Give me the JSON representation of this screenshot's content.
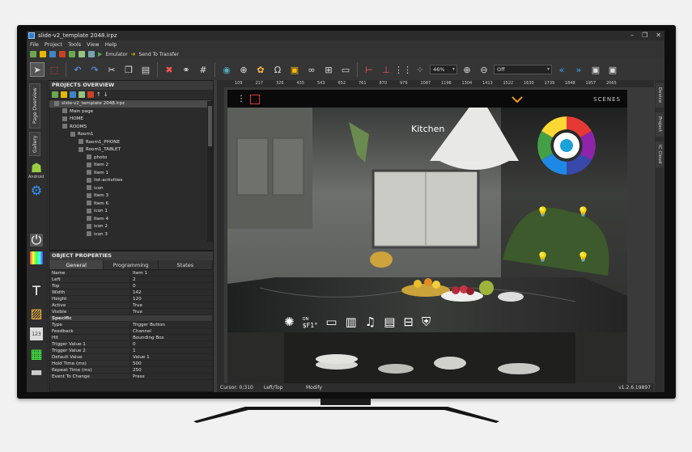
{
  "window": {
    "title": "slide-v2_template 2048.irpz",
    "min": "–",
    "max": "❐",
    "close": "✕"
  },
  "menu": [
    "File",
    "Project",
    "Tools",
    "View",
    "Help"
  ],
  "toolbar1": {
    "emulator": "Emulator",
    "send": "Send To Transfer"
  },
  "toolbar2": {
    "zoom": "46%",
    "off_select": "Off"
  },
  "left_tabs": {
    "page_overview": "Page Overview",
    "gallery": "Gallery",
    "android": "Android"
  },
  "projects_overview": {
    "header": "PROJECTS OVERVIEW",
    "tree": [
      {
        "label": "slide-v2_template 2048.irpz",
        "level": 0
      },
      {
        "label": "Main page",
        "level": 1
      },
      {
        "label": "HOME",
        "level": 1
      },
      {
        "label": "ROOMS",
        "level": 1
      },
      {
        "label": "Room1",
        "level": 2
      },
      {
        "label": "Room1_PHONE",
        "level": 3
      },
      {
        "label": "Room1_TABLET",
        "level": 3
      },
      {
        "label": "photo",
        "level": 4
      },
      {
        "label": "Item 2",
        "level": 4
      },
      {
        "label": "Item 1",
        "level": 4
      },
      {
        "label": "list-activities",
        "level": 4
      },
      {
        "label": "icon",
        "level": 4
      },
      {
        "label": "Item 3",
        "level": 4
      },
      {
        "label": "Item 6",
        "level": 4
      },
      {
        "label": "icon 1",
        "level": 4
      },
      {
        "label": "Item 4",
        "level": 4
      },
      {
        "label": "icon 2",
        "level": 4
      },
      {
        "label": "icon 3",
        "level": 4
      }
    ]
  },
  "object_properties": {
    "header": "OBJECT PROPERTIES",
    "tabs": [
      "General",
      "Programming",
      "States"
    ],
    "rows": [
      {
        "k": "Name",
        "v": "Item 1"
      },
      {
        "k": "Left",
        "v": "2"
      },
      {
        "k": "Top",
        "v": "0"
      },
      {
        "k": "Width",
        "v": "142"
      },
      {
        "k": "Height",
        "v": "120"
      },
      {
        "k": "Active",
        "v": "True"
      },
      {
        "k": "Visible",
        "v": "True"
      },
      {
        "k": "Specific",
        "v": "",
        "section": true
      },
      {
        "k": "Type",
        "v": "Trigger Button"
      },
      {
        "k": "Feedback",
        "v": "Channel"
      },
      {
        "k": "Hit",
        "v": "Bounding Box"
      },
      {
        "k": "Trigger Value 1",
        "v": "0"
      },
      {
        "k": "Trigger Value 2",
        "v": "1"
      },
      {
        "k": "Default Value",
        "v": "Value 1"
      },
      {
        "k": "Hold Time (ms)",
        "v": "500"
      },
      {
        "k": "Repeat Time (ms)",
        "v": "250"
      },
      {
        "k": "Event To Change",
        "v": "Press"
      }
    ]
  },
  "ruler_ticks": [
    "109",
    "217",
    "326",
    "435",
    "543",
    "652",
    "761",
    "870",
    "979",
    "1087",
    "1196",
    "1304",
    "1413",
    "1522",
    "1630",
    "1739",
    "1848",
    "1957",
    "2065"
  ],
  "right_tabs": [
    "Device",
    "Project",
    "IC Cloud"
  ],
  "slide": {
    "room_title": "Kitchen",
    "scenes": "SCENES",
    "ac_on": "ON",
    "temperature": "$F1°"
  },
  "status": {
    "cursor": "Cursor: 0;310",
    "anchor": "Left/Top",
    "mode": "Modify",
    "version": "v1.2.6.19897"
  }
}
